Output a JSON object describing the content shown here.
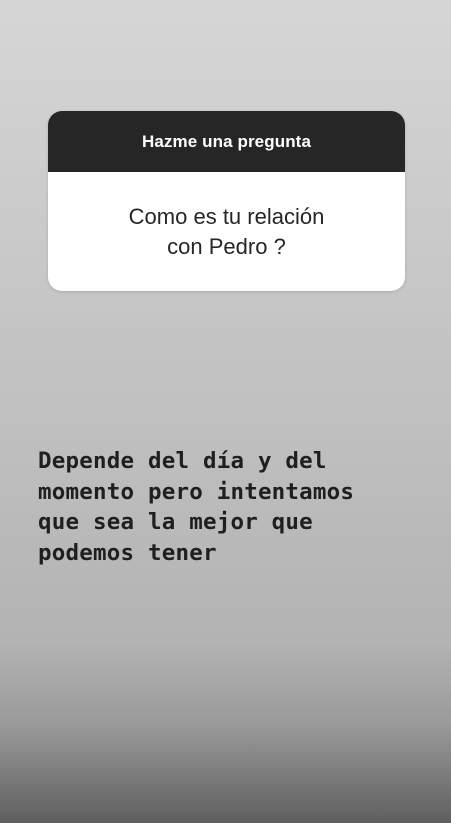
{
  "question_sticker": {
    "header": "Hazme una pregunta",
    "question_line1": "Como es tu relación",
    "question_line2": "con Pedro ?"
  },
  "answer": {
    "lines": [
      "Depende del día y del",
      "momento pero intentamos",
      "que sea la mejor que",
      "podemos tener"
    ]
  }
}
